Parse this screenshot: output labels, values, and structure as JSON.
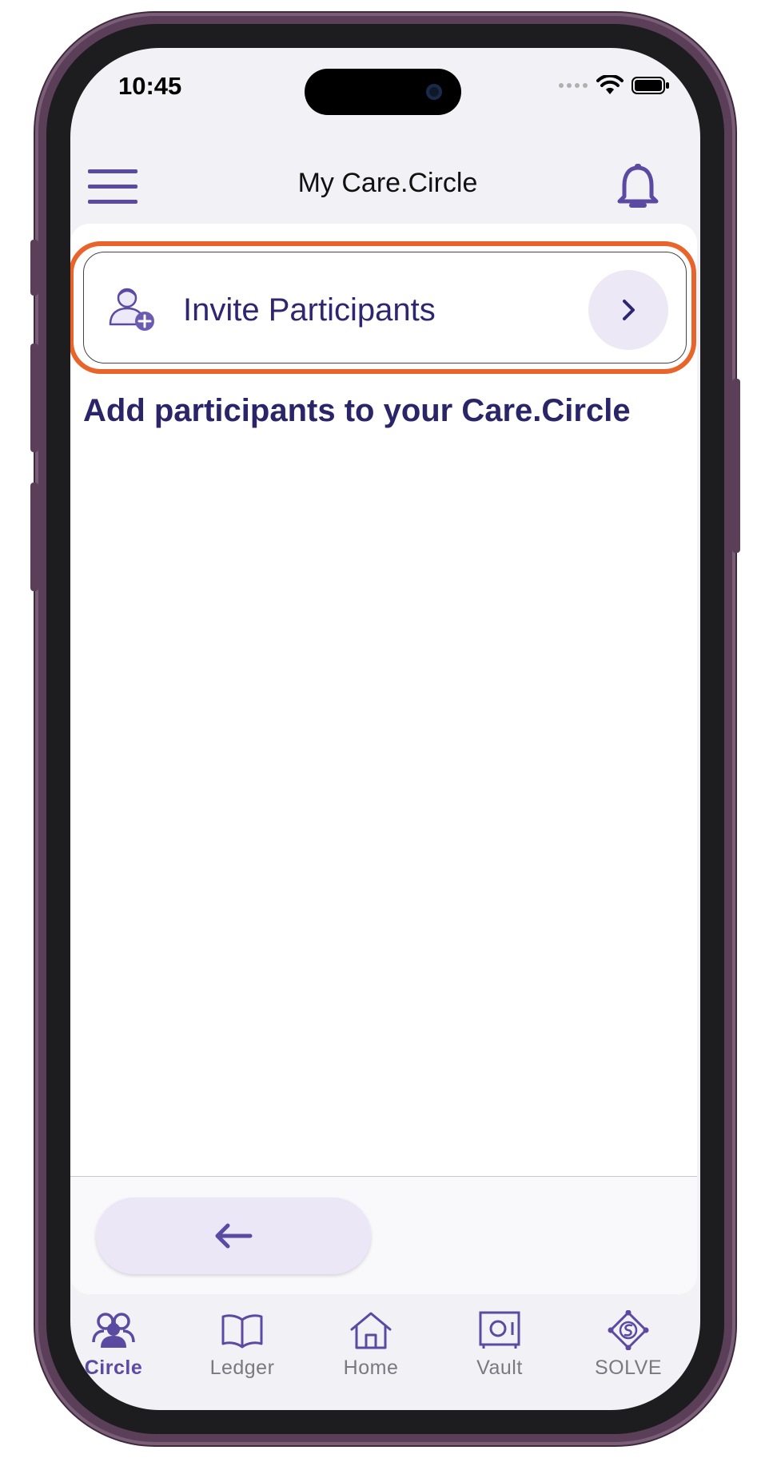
{
  "status_bar": {
    "time": "10:45"
  },
  "header": {
    "title": "My Care.Circle",
    "menu_icon": "hamburger-menu-icon",
    "notification_icon": "bell-icon"
  },
  "invite": {
    "label": "Invite Participants",
    "icon": "add-person-icon",
    "chevron_icon": "chevron-right-icon"
  },
  "helper_text": "Add participants to your Care.Circle",
  "footer": {
    "back_icon": "arrow-left-icon"
  },
  "bottom_nav": {
    "items": [
      {
        "label": "Circle",
        "icon": "people-group-icon",
        "active": true
      },
      {
        "label": "Ledger",
        "icon": "open-book-icon",
        "active": false
      },
      {
        "label": "Home",
        "icon": "house-icon",
        "active": false
      },
      {
        "label": "Vault",
        "icon": "safe-icon",
        "active": false
      },
      {
        "label": "SOLVE",
        "icon": "solve-diamond-icon",
        "active": false
      }
    ]
  },
  "colors": {
    "accent": "#5a4aa2",
    "text_dark_purple": "#2a2469",
    "highlight_orange": "#e9642a",
    "screen_background": "#f2f1f5"
  }
}
